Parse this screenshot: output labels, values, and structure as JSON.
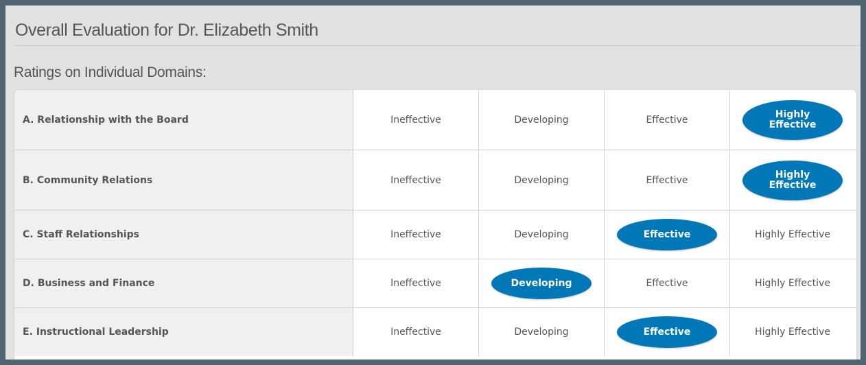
{
  "page": {
    "title": "Overall Evaluation for Dr. Elizabeth Smith",
    "subtitle": "Ratings on Individual Domains:"
  },
  "rating_levels": [
    "Ineffective",
    "Developing",
    "Effective",
    "Highly Effective"
  ],
  "domains": [
    {
      "label": "A. Relationship with the Board",
      "selected": "Highly Effective",
      "cells": [
        "Ineffective",
        "Developing",
        "Effective",
        "Highly\nEffective"
      ]
    },
    {
      "label": "B. Community Relations",
      "selected": "Highly Effective",
      "cells": [
        "Ineffective",
        "Developing",
        "Effective",
        "Highly\nEffective"
      ]
    },
    {
      "label": "C. Staff Relationships",
      "selected": "Effective",
      "cells": [
        "Ineffective",
        "Developing",
        "Effective",
        "Highly Effective"
      ]
    },
    {
      "label": "D. Business and Finance",
      "selected": "Developing",
      "cells": [
        "Ineffective",
        "Developing",
        "Effective",
        "Highly Effective"
      ]
    },
    {
      "label": "E. Instructional Leadership",
      "selected": "Effective",
      "cells": [
        "Ineffective",
        "Developing",
        "Effective",
        "Highly Effective"
      ]
    }
  ],
  "colors": {
    "background": "#4f6672",
    "panel": "#e2e2e2",
    "selected_pill": "#0077b6",
    "text": "#555555"
  }
}
